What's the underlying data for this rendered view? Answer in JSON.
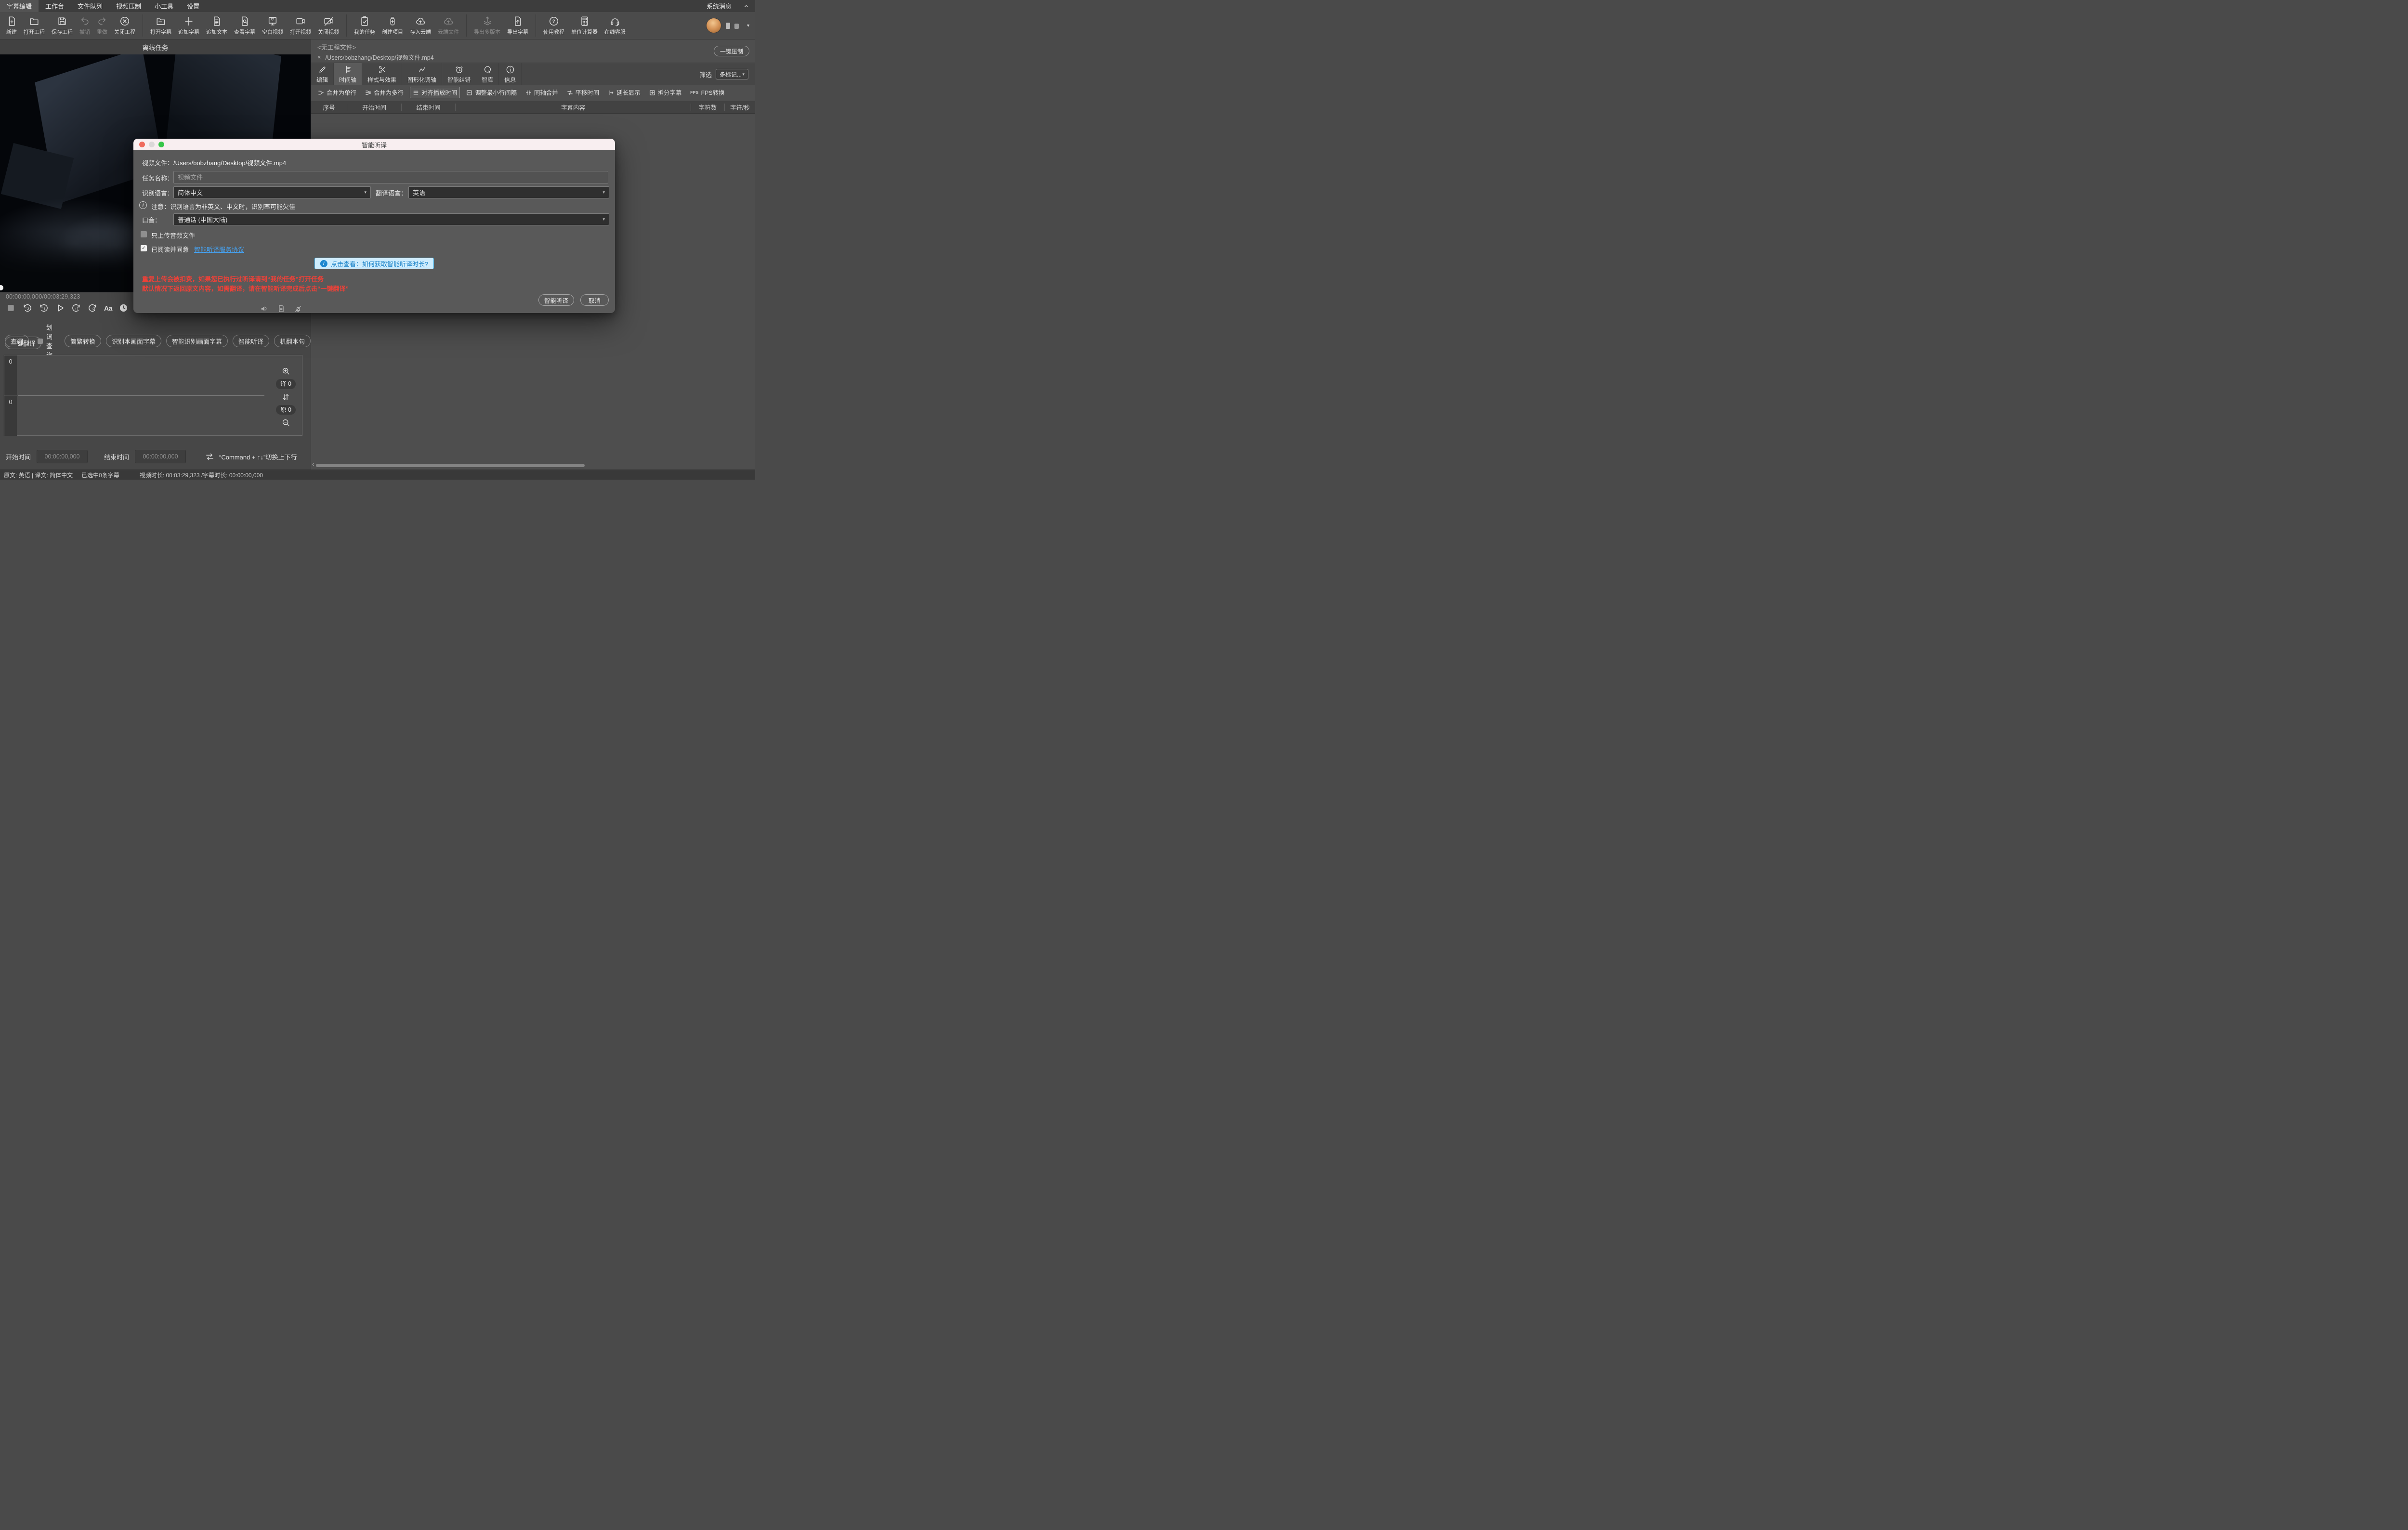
{
  "menu_bar": {
    "items": [
      {
        "label": "字幕编辑",
        "active": true
      },
      {
        "label": "工作台"
      },
      {
        "label": "文件队列"
      },
      {
        "label": "视频压制"
      },
      {
        "label": "小工具"
      },
      {
        "label": "设置"
      }
    ],
    "system_message": "系统消息"
  },
  "toolbar": {
    "groups": [
      {
        "items": [
          {
            "label": "新建"
          },
          {
            "label": "打开工程"
          },
          {
            "label": "保存工程"
          },
          {
            "label": "撤销",
            "disabled": true
          },
          {
            "label": "重做",
            "disabled": true
          },
          {
            "label": "关闭工程"
          }
        ]
      },
      {
        "items": [
          {
            "label": "打开字幕"
          },
          {
            "label": "追加字幕"
          },
          {
            "label": "追加文本"
          },
          {
            "label": "查看字幕"
          },
          {
            "label": "空白视频"
          },
          {
            "label": "打开视频"
          },
          {
            "label": "关闭视频"
          }
        ]
      },
      {
        "items": [
          {
            "label": "我的任务"
          },
          {
            "label": "创建项目"
          },
          {
            "label": "存入云端"
          },
          {
            "label": "云端文件",
            "disabled": true
          }
        ]
      },
      {
        "items": [
          {
            "label": "导出多版本",
            "disabled": true
          },
          {
            "label": "导出字幕"
          }
        ]
      },
      {
        "items": [
          {
            "label": "使用教程"
          },
          {
            "label": "单位计算器"
          },
          {
            "label": "在线客服"
          }
        ]
      }
    ],
    "icon_glyphs": {
      "blank_video": "空"
    }
  },
  "left_panel": {
    "title": "离线任务",
    "timecode": "00:00:00,000/00:03:29,323",
    "player": {
      "skip_back_3": "-3",
      "skip_back_1": "-1",
      "skip_fwd_1": "+1",
      "skip_fwd_3": "+3",
      "font_label": "Aa"
    },
    "actions": {
      "lookup": "查词",
      "lookup_selection": "划词查询",
      "convert": "简繁转换",
      "ocr_frame": "识别本画面字幕",
      "smart_ocr": "智能识别画面字幕",
      "transcribe": "智能听译",
      "mt_sentence": "机翻本句",
      "translate_all": "一键翻译"
    },
    "tracks": {
      "top_count": "0",
      "bottom_count": "0",
      "translated_badge": "译 0",
      "original_badge": "原 0"
    },
    "time_edit": {
      "start_label": "开始时间",
      "start_value": "00:00:00,000",
      "end_label": "结束时间",
      "end_value": "00:00:00,000",
      "hint": "“Command + ↑↓”切换上下行"
    }
  },
  "status_bar": {
    "languages": "原文: 英语 | 译文: 简体中文",
    "selected": "已选中0条字幕",
    "durations": "视频时长: 00:03:29,323 /字幕时长: 00:00:00,000"
  },
  "right_panel": {
    "project_label": "<无工程文件>",
    "file_path": "/Users/bobzhang/Desktop/视频文件.mp4",
    "compress_button": "一键压制",
    "tabs": [
      {
        "label": "编辑"
      },
      {
        "label": "时间轴",
        "active": true
      },
      {
        "label": "样式与效果"
      },
      {
        "label": "图形化调轴"
      },
      {
        "label": "智能纠错"
      },
      {
        "label": "智库"
      },
      {
        "label": "信息"
      }
    ],
    "filter_label": "筛选",
    "filter_value": "多标记...",
    "tools": [
      {
        "label": "合并为单行"
      },
      {
        "label": "合并为多行"
      },
      {
        "label": "对齐播放时间",
        "active": true
      },
      {
        "label": "调整最小行间隔"
      },
      {
        "label": "同轴合并"
      },
      {
        "label": "平移时间"
      },
      {
        "label": "延长显示"
      },
      {
        "label": "拆分字幕"
      },
      {
        "label": "FPS转换",
        "icon_text": "FPS"
      }
    ],
    "table_headers": [
      "序号",
      "开始时间",
      "结束时间",
      "字幕内容",
      "字符数",
      "字符/秒"
    ]
  },
  "dialog": {
    "title": "智能听译",
    "video_file_label": "视频文件：",
    "video_file_value": "/Users/bobzhang/Desktop/视频文件.mp4",
    "task_name_label": "任务名称：",
    "task_name_placeholder": "视频文件",
    "source_lang_label": "识别语言：",
    "source_lang_value": "简体中文",
    "target_lang_label": "翻译语言：",
    "target_lang_value": "英语",
    "notice": "注意：识别语言为非英文、中文时，识别率可能欠佳",
    "accent_label": "口音：",
    "accent_value": "普通话 (中国大陆)",
    "audio_only_label": "只上传音频文件",
    "agree_label": "已阅读并同意",
    "agreement_link": "智能听译服务协议",
    "help_button": "点击查看：如何获取智能听译时长?",
    "warning_line1": "重复上传会被扣费，如果您已执行过听译请到“我的任务”打开任务",
    "warning_line2": "默认情况下返回原文内容，如需翻译，请在智能听译完成后点击“一键翻译”",
    "confirm_button": "智能听译",
    "cancel_button": "取消"
  },
  "icons": {
    "caret_down": "▾",
    "dropdown_triangle": "▼",
    "close": "×",
    "check": "✓",
    "chevron_left": "‹"
  },
  "colors": {
    "accent_blue": "#1d87cf",
    "link_blue": "#45a3f4",
    "warning_red": "#ee4138",
    "titlebar_pink": "#f8eef0",
    "traffic_red": "#ef6b5e",
    "traffic_gray": "#dbd8d8",
    "traffic_green": "#37c649"
  }
}
